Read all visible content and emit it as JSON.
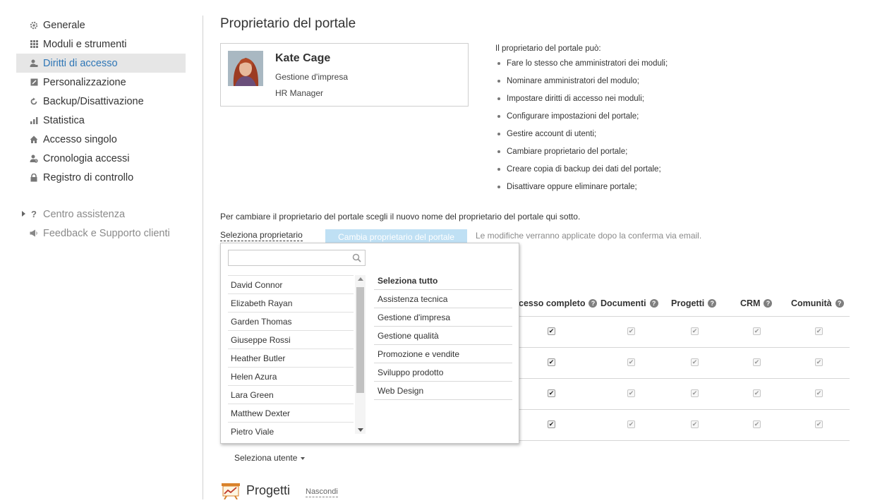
{
  "sidebar": {
    "items": [
      {
        "label": "Generale",
        "icon": "gear-icon"
      },
      {
        "label": "Moduli e strumenti",
        "icon": "grid-icon"
      },
      {
        "label": "Diritti di accesso",
        "icon": "user-key-icon",
        "active": true
      },
      {
        "label": "Personalizzazione",
        "icon": "edit-icon"
      },
      {
        "label": "Backup/Disattivazione",
        "icon": "refresh-icon"
      },
      {
        "label": "Statistica",
        "icon": "bar-chart-icon"
      },
      {
        "label": "Accesso singolo",
        "icon": "home-icon"
      },
      {
        "label": "Cronologia accessi",
        "icon": "user-clock-icon"
      },
      {
        "label": "Registro di controllo",
        "icon": "lock-icon"
      }
    ],
    "help_center": "Centro assistenza",
    "feedback": "Feedback e Supporto clienti"
  },
  "main": {
    "title": "Proprietario del portale",
    "owner": {
      "name": "Kate Cage",
      "department": "Gestione d'impresa",
      "role": "HR Manager"
    },
    "capabilities_heading": "Il proprietario del portale può:",
    "capabilities": [
      "Fare lo stesso che amministratori dei moduli;",
      "Nominare amministratori del modulo;",
      "Impostare diritti di accesso nei moduli;",
      "Configurare impostazioni del portale;",
      "Gestire account di utenti;",
      "Cambiare proprietario del portale;",
      "Creare copia di backup dei dati del portale;",
      "Disattivare oppure eliminare portale;"
    ],
    "change_info": "Per cambiare il proprietario del portale scegli il nuovo nome del proprietario del portale qui sotto.",
    "select_owner_label": "Seleziona proprietario",
    "change_button": "Cambia proprietario del portale",
    "email_note": "Le modifiche verranno applicate dopo la conferma via email.",
    "table": {
      "columns": [
        "cesso completo",
        "Documenti",
        "Progetti",
        "CRM",
        "Comunità"
      ],
      "rows": 4
    },
    "select_user": "Seleziona utente",
    "projects_title": "Progetti",
    "hide_link": "Nascondi"
  },
  "dropdown": {
    "search_value": "",
    "users": [
      "David Connor",
      "Elizabeth Rayan",
      "Garden Thomas",
      "Giuseppe Rossi",
      "Heather Butler",
      "Helen Azura",
      "Lara Green",
      "Matthew Dexter",
      "Pietro Viale"
    ],
    "select_all": "Seleziona tutto",
    "groups": [
      "Assistenza tecnica",
      "Gestione d'impresa",
      "Gestione qualità",
      "Promozione e vendite",
      "Sviluppo prodotto",
      "Web Design"
    ]
  },
  "colors": {
    "accent": "#2e76b6",
    "button_disabled": "#bfe0f4",
    "active_bg": "#e6e6e6"
  }
}
